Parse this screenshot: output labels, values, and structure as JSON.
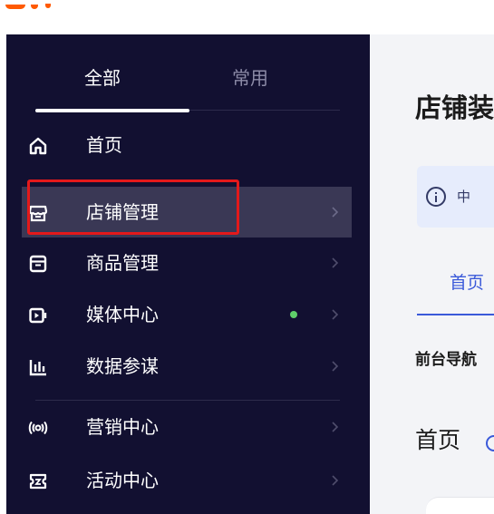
{
  "sidebar": {
    "tabs": [
      {
        "label": "全部",
        "active": true
      },
      {
        "label": "常用",
        "active": false
      }
    ],
    "items": [
      {
        "label": "首页",
        "icon": "home-icon",
        "chevron": false
      },
      {
        "label": "店铺管理",
        "icon": "store-icon",
        "chevron": true,
        "active": true
      },
      {
        "label": "商品管理",
        "icon": "product-box-icon",
        "chevron": true
      },
      {
        "label": "媒体中心",
        "icon": "media-play-icon",
        "chevron": true,
        "badge": "green-dot"
      },
      {
        "label": "数据参谋",
        "icon": "bar-chart-icon",
        "chevron": true
      },
      {
        "label": "营销中心",
        "icon": "broadcast-icon",
        "chevron": true
      },
      {
        "label": "活动中心",
        "icon": "ticket-icon",
        "chevron": true
      }
    ]
  },
  "content": {
    "title": "店铺装",
    "notice_text": "中",
    "tab_home": "首页",
    "nav_label": "前台导航",
    "section_head": "首页"
  },
  "colors": {
    "sidebar_bg": "#121031",
    "active_item_bg": "#3a3855",
    "highlight_border": "#e3191b",
    "accent_blue": "#3a59d9",
    "badge_green": "#5fcf6a",
    "logo_orange": "#ff5a00"
  }
}
